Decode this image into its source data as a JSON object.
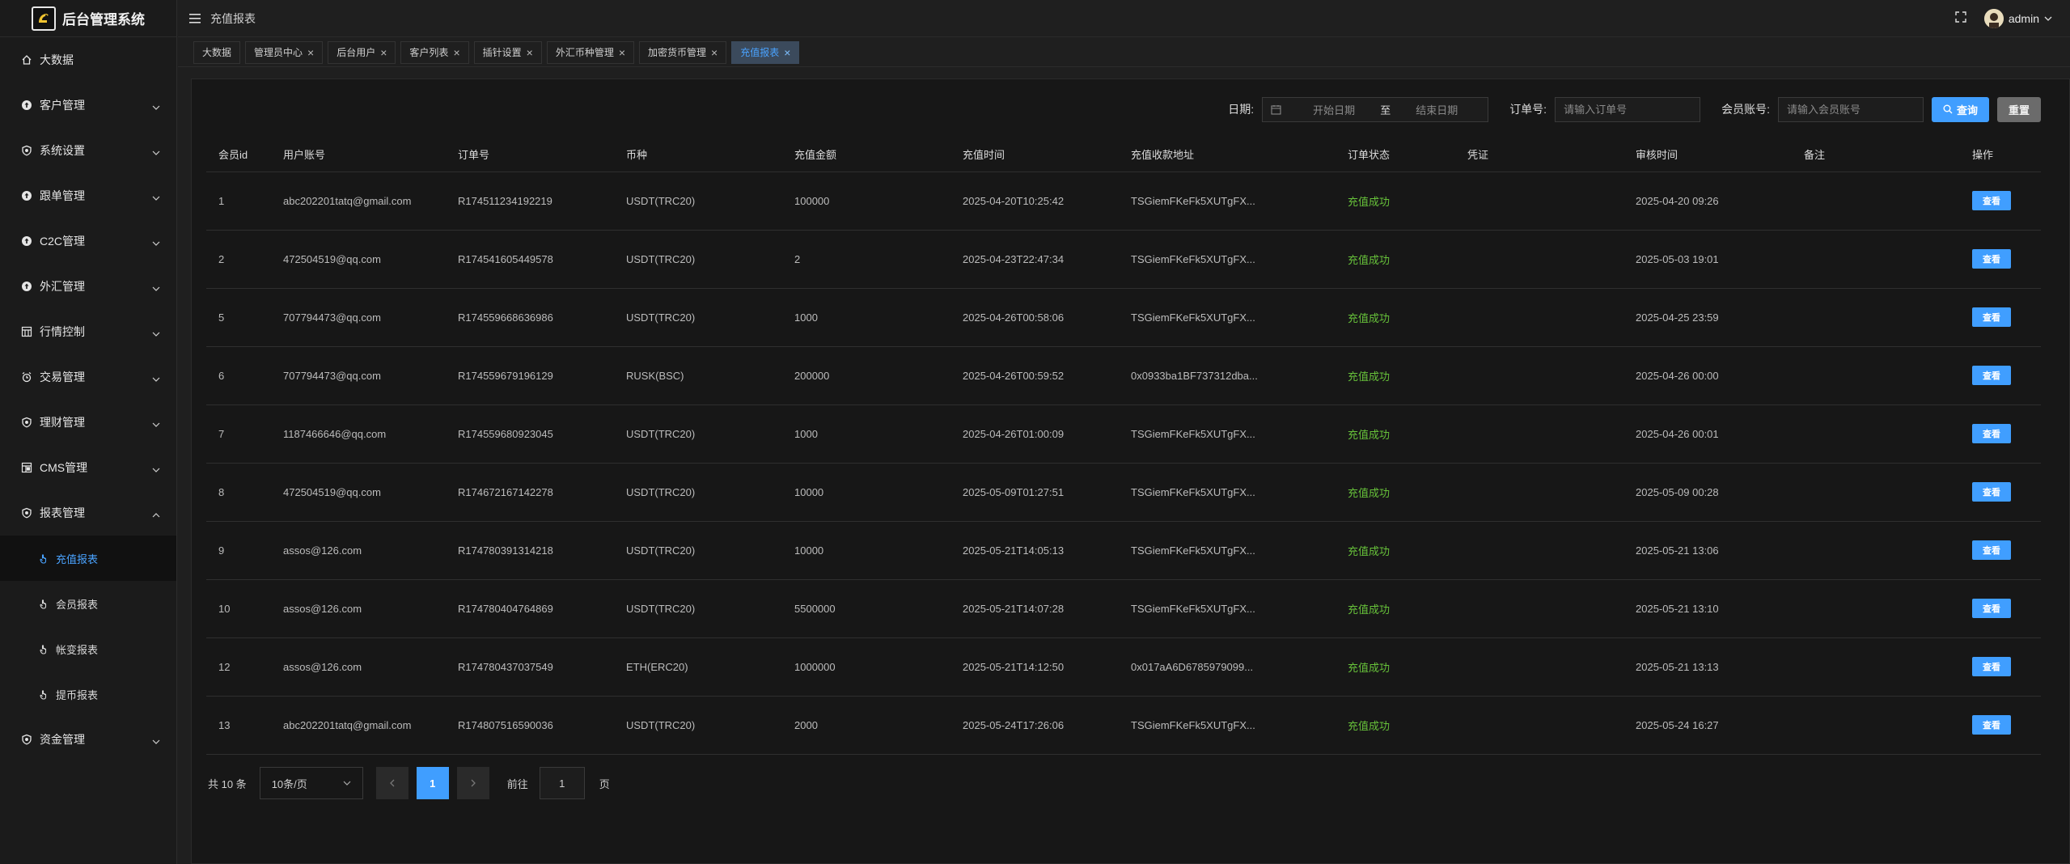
{
  "app": {
    "title": "后台管理系统"
  },
  "sidebar": {
    "items": [
      {
        "label": "大数据",
        "icon": "home-icon",
        "expandable": false
      },
      {
        "label": "客户管理",
        "icon": "upload-circle-icon",
        "expandable": true
      },
      {
        "label": "系统设置",
        "icon": "shield-icon",
        "expandable": true
      },
      {
        "label": "跟单管理",
        "icon": "upload-circle-icon",
        "expandable": true
      },
      {
        "label": "C2C管理",
        "icon": "upload-circle-icon",
        "expandable": true
      },
      {
        "label": "外汇管理",
        "icon": "upload-circle-icon",
        "expandable": true
      },
      {
        "label": "行情控制",
        "icon": "calendar-grid-icon",
        "expandable": true
      },
      {
        "label": "交易管理",
        "icon": "alarm-clock-icon",
        "expandable": true
      },
      {
        "label": "理财管理",
        "icon": "shield-icon",
        "expandable": true
      },
      {
        "label": "CMS管理",
        "icon": "layout-icon",
        "expandable": true
      },
      {
        "label": "报表管理",
        "icon": "shield-icon",
        "expandable": true,
        "expanded": true
      },
      {
        "label": "资金管理",
        "icon": "shield-icon",
        "expandable": true
      }
    ],
    "report_children": [
      {
        "label": "充值报表",
        "active": true
      },
      {
        "label": "会员报表",
        "active": false
      },
      {
        "label": "帐变报表",
        "active": false
      },
      {
        "label": "提币报表",
        "active": false
      }
    ]
  },
  "header": {
    "breadcrumb": "充值报表",
    "user": "admin"
  },
  "tabs": [
    {
      "label": "大数据",
      "closable": false,
      "active": false
    },
    {
      "label": "管理员中心",
      "closable": true,
      "active": false
    },
    {
      "label": "后台用户",
      "closable": true,
      "active": false
    },
    {
      "label": "客户列表",
      "closable": true,
      "active": false
    },
    {
      "label": "插针设置",
      "closable": true,
      "active": false
    },
    {
      "label": "外汇币种管理",
      "closable": true,
      "active": false
    },
    {
      "label": "加密货币管理",
      "closable": true,
      "active": false
    },
    {
      "label": "充值报表",
      "closable": true,
      "active": true
    }
  ],
  "filters": {
    "date_label": "日期:",
    "start_placeholder": "开始日期",
    "range_separator": "至",
    "end_placeholder": "结束日期",
    "order_label": "订单号:",
    "order_placeholder": "请输入订单号",
    "member_label": "会员账号:",
    "member_placeholder": "请输入会员账号",
    "search_label": "查询",
    "reset_label": "重置"
  },
  "table": {
    "columns": [
      "会员id",
      "用户账号",
      "订单号",
      "币种",
      "充值金额",
      "充值时间",
      "充值收款地址",
      "订单状态",
      "凭证",
      "审核时间",
      "备注",
      "操作"
    ],
    "action_label": "查看",
    "rows": [
      {
        "id": "1",
        "account": "abc202201tatq@gmail.com",
        "order": "R174511234192219",
        "currency": "USDT(TRC20)",
        "amount": "100000",
        "time": "2025-04-20T10:25:42",
        "address": "TSGiemFKeFk5XUTgFX...",
        "status": "充值成功",
        "voucher": "",
        "audit": "2025-04-20 09:26",
        "note": ""
      },
      {
        "id": "2",
        "account": "472504519@qq.com",
        "order": "R174541605449578",
        "currency": "USDT(TRC20)",
        "amount": "2",
        "time": "2025-04-23T22:47:34",
        "address": "TSGiemFKeFk5XUTgFX...",
        "status": "充值成功",
        "voucher": "",
        "audit": "2025-05-03 19:01",
        "note": ""
      },
      {
        "id": "5",
        "account": "707794473@qq.com",
        "order": "R174559668636986",
        "currency": "USDT(TRC20)",
        "amount": "1000",
        "time": "2025-04-26T00:58:06",
        "address": "TSGiemFKeFk5XUTgFX...",
        "status": "充值成功",
        "voucher": "",
        "audit": "2025-04-25 23:59",
        "note": ""
      },
      {
        "id": "6",
        "account": "707794473@qq.com",
        "order": "R174559679196129",
        "currency": "RUSK(BSC)",
        "amount": "200000",
        "time": "2025-04-26T00:59:52",
        "address": "0x0933ba1BF737312dba...",
        "status": "充值成功",
        "voucher": "",
        "audit": "2025-04-26 00:00",
        "note": ""
      },
      {
        "id": "7",
        "account": "1187466646@qq.com",
        "order": "R174559680923045",
        "currency": "USDT(TRC20)",
        "amount": "1000",
        "time": "2025-04-26T01:00:09",
        "address": "TSGiemFKeFk5XUTgFX...",
        "status": "充值成功",
        "voucher": "",
        "audit": "2025-04-26 00:01",
        "note": ""
      },
      {
        "id": "8",
        "account": "472504519@qq.com",
        "order": "R174672167142278",
        "currency": "USDT(TRC20)",
        "amount": "10000",
        "time": "2025-05-09T01:27:51",
        "address": "TSGiemFKeFk5XUTgFX...",
        "status": "充值成功",
        "voucher": "",
        "audit": "2025-05-09 00:28",
        "note": ""
      },
      {
        "id": "9",
        "account": "assos@126.com",
        "order": "R174780391314218",
        "currency": "USDT(TRC20)",
        "amount": "10000",
        "time": "2025-05-21T14:05:13",
        "address": "TSGiemFKeFk5XUTgFX...",
        "status": "充值成功",
        "voucher": "",
        "audit": "2025-05-21 13:06",
        "note": ""
      },
      {
        "id": "10",
        "account": "assos@126.com",
        "order": "R174780404764869",
        "currency": "USDT(TRC20)",
        "amount": "5500000",
        "time": "2025-05-21T14:07:28",
        "address": "TSGiemFKeFk5XUTgFX...",
        "status": "充值成功",
        "voucher": "",
        "audit": "2025-05-21 13:10",
        "note": ""
      },
      {
        "id": "12",
        "account": "assos@126.com",
        "order": "R174780437037549",
        "currency": "ETH(ERC20)",
        "amount": "1000000",
        "time": "2025-05-21T14:12:50",
        "address": "0x017aA6D6785979099...",
        "status": "充值成功",
        "voucher": "",
        "audit": "2025-05-21 13:13",
        "note": ""
      },
      {
        "id": "13",
        "account": "abc202201tatq@gmail.com",
        "order": "R174807516590036",
        "currency": "USDT(TRC20)",
        "amount": "2000",
        "time": "2025-05-24T17:26:06",
        "address": "TSGiemFKeFk5XUTgFX...",
        "status": "充值成功",
        "voucher": "",
        "audit": "2025-05-24 16:27",
        "note": ""
      }
    ]
  },
  "pagination": {
    "total": "共 10 条",
    "page_size": "10条/页",
    "current_page": "1",
    "goto_label": "前往",
    "goto_value": "1",
    "page_unit": "页"
  },
  "colors": {
    "accent": "#409eff",
    "success": "#67c23a",
    "background": "#1f1f1f"
  }
}
